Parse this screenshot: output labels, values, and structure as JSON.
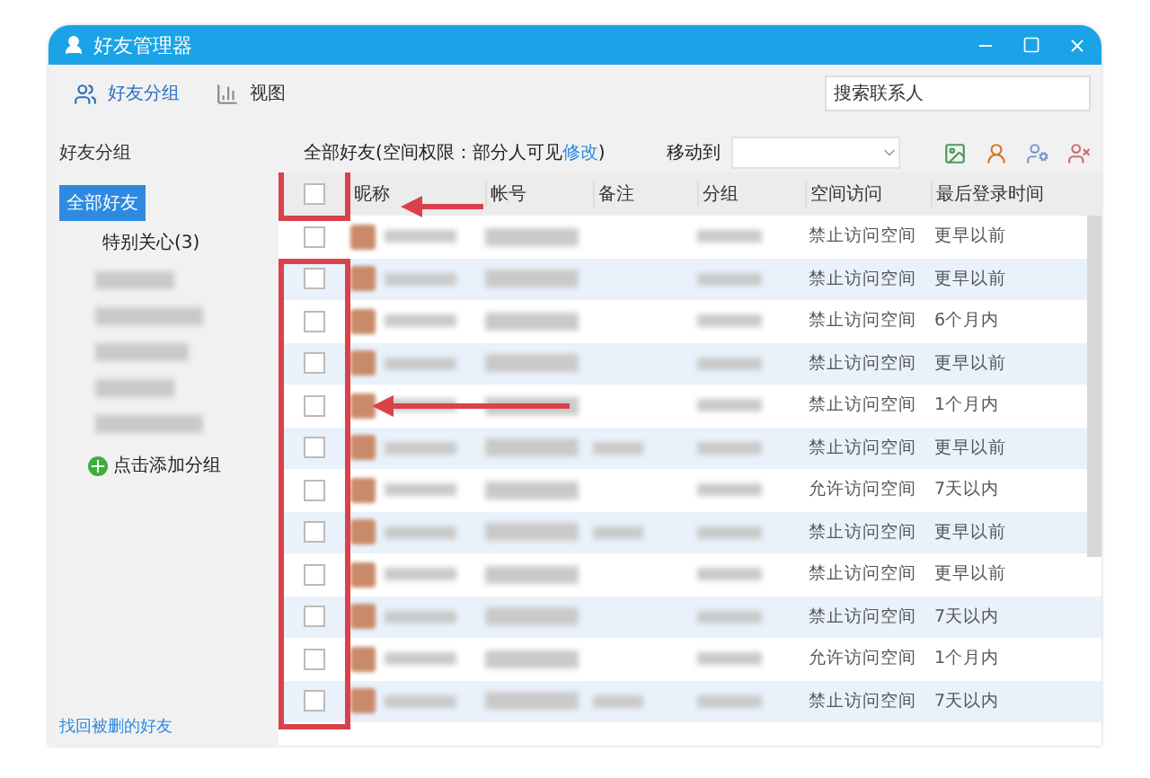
{
  "window": {
    "title": "好友管理器"
  },
  "toolbar": {
    "tabs": [
      {
        "label": "好友分组",
        "selected": true,
        "kind": "group"
      },
      {
        "label": "视图",
        "selected": false,
        "kind": "view"
      }
    ],
    "search": {
      "placeholder": "搜索联系人"
    }
  },
  "sidebar": {
    "heading": "好友分组",
    "items": [
      {
        "kind": "named",
        "label": "全部好友",
        "selected": true
      },
      {
        "kind": "named",
        "label": "特别关心(3)",
        "selected": false
      },
      {
        "kind": "redacted"
      },
      {
        "kind": "redacted"
      },
      {
        "kind": "redacted"
      },
      {
        "kind": "redacted"
      },
      {
        "kind": "redacted"
      }
    ],
    "add_group": "点击添加分组",
    "footer_link": "找回被删的好友"
  },
  "list": {
    "title": "全部好友(空间权限：部分人可见",
    "edit_link": "修改",
    "title_end": ")",
    "move_to": "移动到",
    "select_all_checked": false,
    "columns": [
      "昵称",
      "帐号",
      "备注",
      "分组",
      "空间访问",
      "最后登录时间"
    ],
    "rows": [
      {
        "checked": false,
        "has_note": false,
        "access": "禁止访问空间",
        "last_login": "更早以前"
      },
      {
        "checked": false,
        "has_note": false,
        "access": "禁止访问空间",
        "last_login": "更早以前"
      },
      {
        "checked": false,
        "has_note": false,
        "access": "禁止访问空间",
        "last_login": "6个月内"
      },
      {
        "checked": false,
        "has_note": false,
        "access": "禁止访问空间",
        "last_login": "更早以前"
      },
      {
        "checked": false,
        "has_note": false,
        "access": "禁止访问空间",
        "last_login": "1个月内"
      },
      {
        "checked": false,
        "has_note": true,
        "access": "禁止访问空间",
        "last_login": "更早以前"
      },
      {
        "checked": false,
        "has_note": false,
        "access": "允许访问空间",
        "last_login": "7天以内"
      },
      {
        "checked": false,
        "has_note": true,
        "access": "禁止访问空间",
        "last_login": "更早以前"
      },
      {
        "checked": false,
        "has_note": false,
        "access": "禁止访问空间",
        "last_login": "更早以前"
      },
      {
        "checked": false,
        "has_note": false,
        "access": "禁止访问空间",
        "last_login": "7天以内"
      },
      {
        "checked": false,
        "has_note": false,
        "access": "允许访问空间",
        "last_login": "1个月内"
      },
      {
        "checked": false,
        "has_note": true,
        "access": "禁止访问空间",
        "last_login": "7天以内"
      }
    ]
  }
}
